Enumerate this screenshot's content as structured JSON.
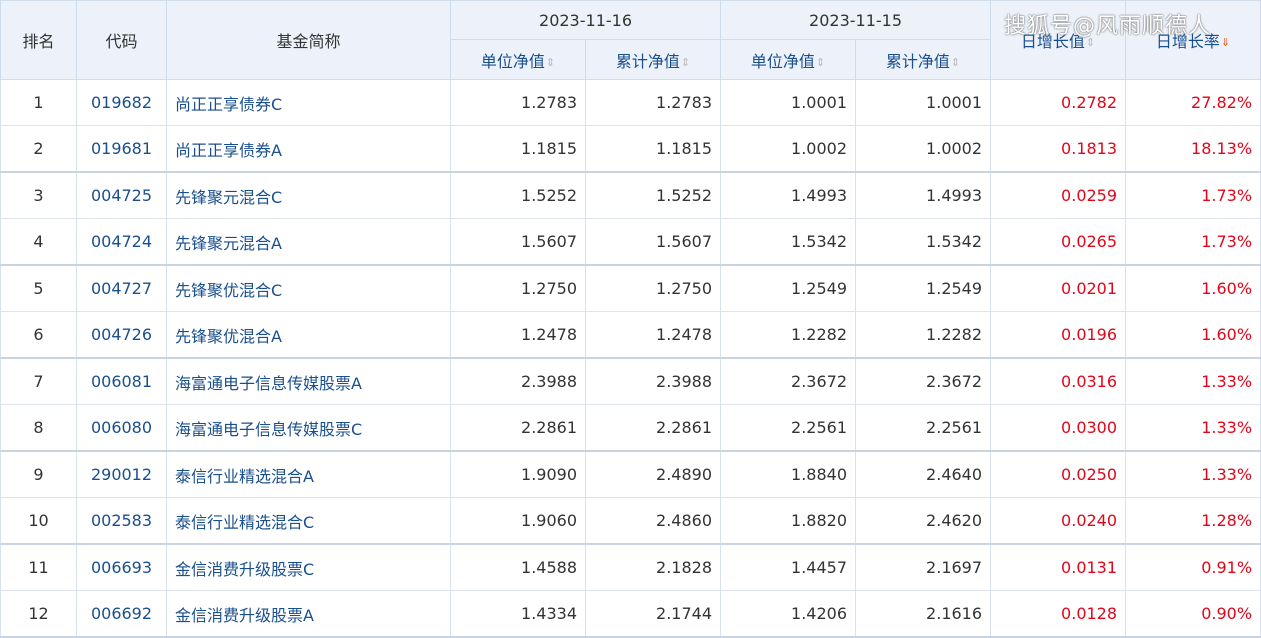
{
  "header": {
    "rank": "排名",
    "code": "代码",
    "name": "基金简称",
    "date1": "2023-11-16",
    "date2": "2023-11-15",
    "unit_nav": "单位净值",
    "acc_nav": "累计净值",
    "daily_growth_value": "日增长值",
    "daily_growth_rate": "日增长率"
  },
  "watermark": "搜狐号@风雨顺德人",
  "rows": [
    {
      "rank": "1",
      "code": "019682",
      "name": "尚正正享债券C",
      "u1": "1.2783",
      "a1": "1.2783",
      "u2": "1.0001",
      "a2": "1.0001",
      "gv": "0.2782",
      "gr": "27.82%"
    },
    {
      "rank": "2",
      "code": "019681",
      "name": "尚正正享债券A",
      "u1": "1.1815",
      "a1": "1.1815",
      "u2": "1.0002",
      "a2": "1.0002",
      "gv": "0.1813",
      "gr": "18.13%"
    },
    {
      "rank": "3",
      "code": "004725",
      "name": "先锋聚元混合C",
      "u1": "1.5252",
      "a1": "1.5252",
      "u2": "1.4993",
      "a2": "1.4993",
      "gv": "0.0259",
      "gr": "1.73%"
    },
    {
      "rank": "4",
      "code": "004724",
      "name": "先锋聚元混合A",
      "u1": "1.5607",
      "a1": "1.5607",
      "u2": "1.5342",
      "a2": "1.5342",
      "gv": "0.0265",
      "gr": "1.73%"
    },
    {
      "rank": "5",
      "code": "004727",
      "name": "先锋聚优混合C",
      "u1": "1.2750",
      "a1": "1.2750",
      "u2": "1.2549",
      "a2": "1.2549",
      "gv": "0.0201",
      "gr": "1.60%"
    },
    {
      "rank": "6",
      "code": "004726",
      "name": "先锋聚优混合A",
      "u1": "1.2478",
      "a1": "1.2478",
      "u2": "1.2282",
      "a2": "1.2282",
      "gv": "0.0196",
      "gr": "1.60%"
    },
    {
      "rank": "7",
      "code": "006081",
      "name": "海富通电子信息传媒股票A",
      "u1": "2.3988",
      "a1": "2.3988",
      "u2": "2.3672",
      "a2": "2.3672",
      "gv": "0.0316",
      "gr": "1.33%"
    },
    {
      "rank": "8",
      "code": "006080",
      "name": "海富通电子信息传媒股票C",
      "u1": "2.2861",
      "a1": "2.2861",
      "u2": "2.2561",
      "a2": "2.2561",
      "gv": "0.0300",
      "gr": "1.33%"
    },
    {
      "rank": "9",
      "code": "290012",
      "name": "泰信行业精选混合A",
      "u1": "1.9090",
      "a1": "2.4890",
      "u2": "1.8840",
      "a2": "2.4640",
      "gv": "0.0250",
      "gr": "1.33%"
    },
    {
      "rank": "10",
      "code": "002583",
      "name": "泰信行业精选混合C",
      "u1": "1.9060",
      "a1": "2.4860",
      "u2": "1.8820",
      "a2": "2.4620",
      "gv": "0.0240",
      "gr": "1.28%"
    },
    {
      "rank": "11",
      "code": "006693",
      "name": "金信消费升级股票C",
      "u1": "1.4588",
      "a1": "2.1828",
      "u2": "1.4457",
      "a2": "2.1697",
      "gv": "0.0131",
      "gr": "0.91%"
    },
    {
      "rank": "12",
      "code": "006692",
      "name": "金信消费升级股票A",
      "u1": "1.4334",
      "a1": "2.1744",
      "u2": "1.4206",
      "a2": "2.1616",
      "gv": "0.0128",
      "gr": "0.90%"
    }
  ]
}
